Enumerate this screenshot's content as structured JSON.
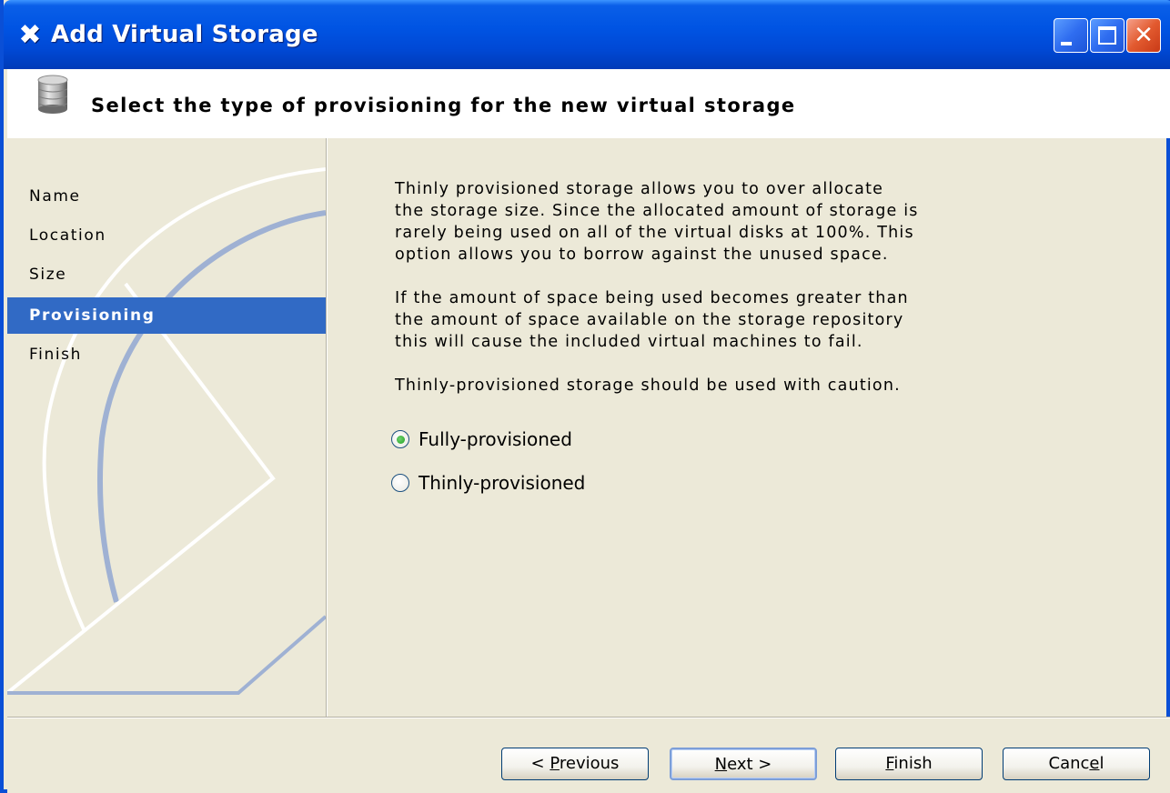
{
  "window": {
    "title": "Add Virtual Storage",
    "app_icon": "x-logo-icon",
    "controls": [
      "minimize-icon",
      "maximize-icon",
      "close-icon"
    ]
  },
  "header": {
    "title": "Select the type of provisioning for the new virtual storage",
    "icon": "database-icon"
  },
  "sidebar": {
    "items": [
      {
        "label": "Name",
        "active": false
      },
      {
        "label": "Location",
        "active": false
      },
      {
        "label": "Size",
        "active": false
      },
      {
        "label": "Provisioning",
        "active": true
      },
      {
        "label": "Finish",
        "active": false
      }
    ],
    "active_color": "#316ac5"
  },
  "content": {
    "paragraph1": "Thinly provisioned storage allows you to over allocate\nthe storage size. Since the allocated amount of storage is\nrarely being used on all of the virtual disks at 100%. This\noption allows you to borrow against the unused space.",
    "paragraph2": "If the amount of space being used becomes greater than\nthe amount of space available on the storage repository\nthis will cause the included virtual machines to fail.",
    "paragraph3": "Thinly-provisioned storage should be used with caution.",
    "options": [
      {
        "label": "Fully-provisioned",
        "checked": true
      },
      {
        "label": "Thinly-provisioned",
        "checked": false
      }
    ]
  },
  "buttons": {
    "previous": {
      "prefix": "< ",
      "mnemonic": "P",
      "rest": "revious"
    },
    "next": {
      "prefix": "",
      "mnemonic": "N",
      "rest": "ext >"
    },
    "finish": {
      "prefix": "",
      "mnemonic": "F",
      "rest": "inish"
    },
    "cancel": {
      "prefix": "Canc",
      "mnemonic": "e",
      "rest": "l"
    }
  }
}
